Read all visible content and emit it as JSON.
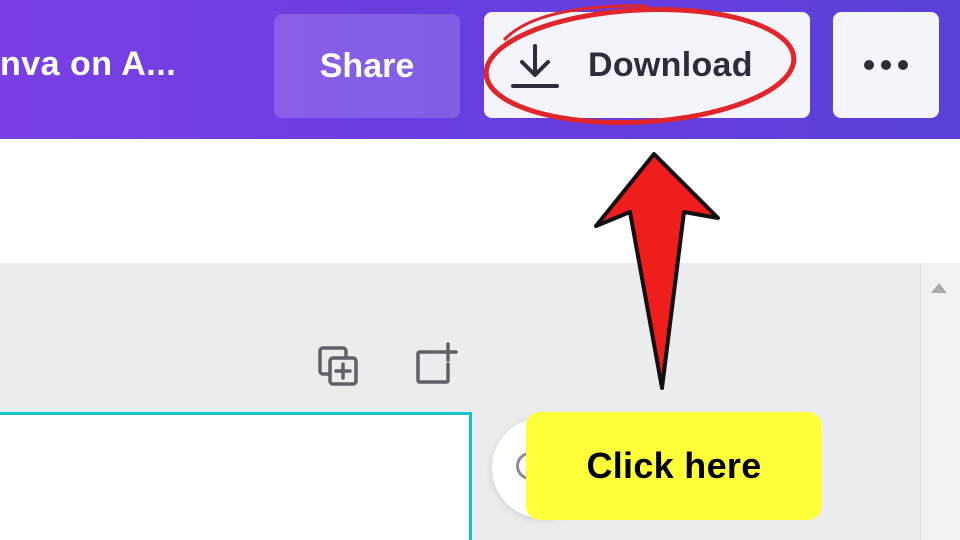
{
  "header": {
    "doc_title": "nva on A...",
    "share_label": "Share",
    "download_label": "Download",
    "more_icon": "more-horizontal-icon",
    "download_icon": "download-icon"
  },
  "canvas_tools": {
    "duplicate_icon": "duplicate-page-icon",
    "add_icon": "add-page-icon"
  },
  "annotation": {
    "callout_text": "Click here",
    "arrow_icon": "red-arrow-up",
    "highlight_color": "#e0262b",
    "callout_color": "#ffff3a"
  },
  "colors": {
    "header_gradient_start": "#7a3fe4",
    "header_gradient_end": "#5b3fd8",
    "selection_border": "#16c5c8"
  }
}
